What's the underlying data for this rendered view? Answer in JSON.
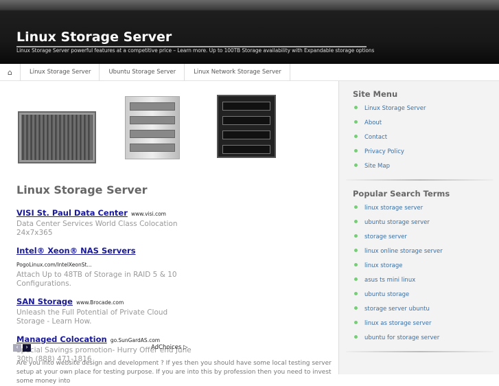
{
  "header": {
    "title": "Linux Storage Server",
    "tagline": "Linux Storage Server powerful features at a competitive price – Learn more. Up to 100TB Storage availability with Expandable storage options"
  },
  "nav": {
    "home_icon": "home-icon",
    "items": [
      "Linux Storage Server",
      "Ubuntu Storage Server",
      "Linux Network Storage Server"
    ]
  },
  "main": {
    "title": "Linux Storage Server",
    "ads": [
      {
        "title": "VISI St. Paul Data Center",
        "url": "www.visi.com",
        "desc": "Data Center Services World Class Colocation 24x7x365"
      },
      {
        "title": "Intel® Xeon® NAS Servers",
        "url": "PogoLinux.com/IntelXeonSt...",
        "desc": "Attach Up to 48TB of Storage in RAID 5 & 10 Configurations."
      },
      {
        "title": "SAN Storage",
        "url": "www.Brocade.com",
        "desc": "Unleash the Full Potential of Private Cloud Storage - Learn How."
      },
      {
        "title": "Managed Colocation",
        "url": "go.SunGardAS.com",
        "desc": "Special Savings promotion- Hurry Offer end June 30th (888) 471-1816"
      }
    ],
    "ad_prev": "‹",
    "ad_next": "›",
    "adchoices": "AdChoices ▷",
    "body": "Are you into website design and development ? If yes then you should have some local testing server setup at your own place for testing purpose. If you are into this by profession then you need to invest some money into"
  },
  "sidebar": {
    "menu_title": "Site Menu",
    "menu": [
      "Linux Storage Server",
      "About",
      "Contact",
      "Privacy Policy",
      "Site Map"
    ],
    "search_title": "Popular Search Terms",
    "search": [
      "linux storage server",
      "ubuntu storage server",
      "storage server",
      "linux online storage server",
      "linux storage",
      "asus ts mini linux",
      "ubuntu storage",
      "storage server ubuntu",
      "linux as storage server",
      "ubuntu for storage server"
    ]
  }
}
